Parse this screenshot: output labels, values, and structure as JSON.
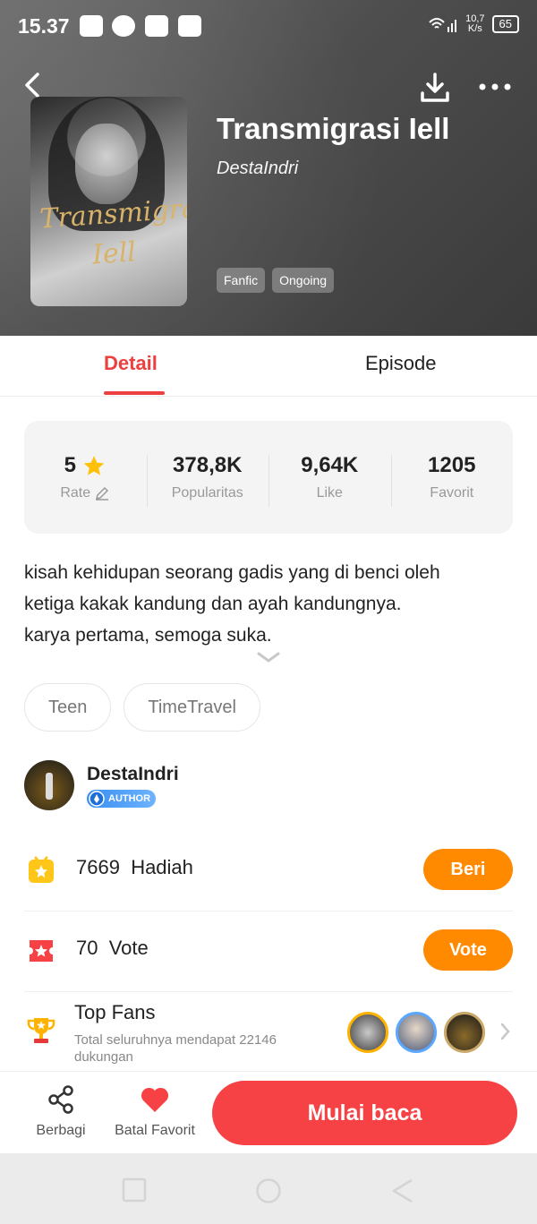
{
  "status_bar": {
    "time": "15.37",
    "net_speed_value": "10,7",
    "net_speed_unit": "K/s",
    "battery": "65"
  },
  "book": {
    "title": "Transmigrasi Iell",
    "author": "DestaIndri",
    "cover_text": "Transmigrasi Iell",
    "tags": [
      "Fanfic",
      "Ongoing"
    ]
  },
  "tabs": [
    {
      "label": "Detail",
      "active": true
    },
    {
      "label": "Episode",
      "active": false
    }
  ],
  "stats": [
    {
      "value": "5",
      "label": "Rate"
    },
    {
      "value": "378,8K",
      "label": "Popularitas"
    },
    {
      "value": "9,64K",
      "label": "Like"
    },
    {
      "value": "1205",
      "label": "Favorit"
    }
  ],
  "description": {
    "line1": "kisah kehidupan seorang gadis yang di benci oleh",
    "line2": "ketiga kakak kandung dan ayah kandungnya.",
    "line3": "karya pertama, semoga suka."
  },
  "genres": [
    "Teen",
    "TimeTravel"
  ],
  "author_block": {
    "name": "DestaIndri",
    "badge": "AUTHOR"
  },
  "hadiah": {
    "count": "7669",
    "label": "Hadiah",
    "button": "Beri"
  },
  "vote": {
    "count": "70",
    "label": "Vote",
    "button": "Vote"
  },
  "top_fans": {
    "title": "Top Fans",
    "subtitle": "Total seluruhnya mendapat 22146 dukungan"
  },
  "bottom_bar": {
    "share": "Berbagi",
    "favorite": "Batal Favorit",
    "read": "Mulai baca"
  },
  "colors": {
    "accent": "#ec3f3f",
    "button_orange": "#ff8a00",
    "read_button": "#f64245",
    "star": "#ffc107"
  }
}
